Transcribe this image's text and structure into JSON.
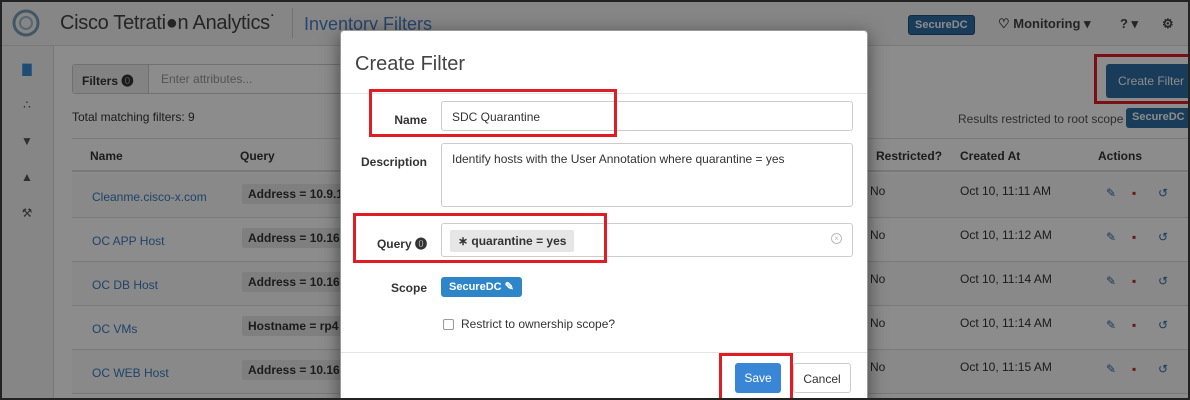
{
  "header": {
    "brand": "Cisco Tetrati●n Analytics˙",
    "page_title": "Inventory Filters",
    "scope_badge": "SecureDC",
    "monitoring_label": "♡ Monitoring ▾",
    "help_label": "? ▾",
    "settings_icon": "gear-icon"
  },
  "sidebar": {
    "items": [
      {
        "icon": "chart-icon",
        "glyph": "▇"
      },
      {
        "icon": "hierarchy-icon",
        "glyph": "∴"
      },
      {
        "icon": "shield-icon",
        "glyph": "▼"
      },
      {
        "icon": "flask-icon",
        "glyph": "▲"
      },
      {
        "icon": "wrench-icon",
        "glyph": "⚒"
      }
    ]
  },
  "filters": {
    "label": "Filters ⓿",
    "placeholder": "Enter attributes...",
    "total": "Total matching filters: 9",
    "restricted_note": "Results restricted to root scope",
    "root_scope": "SecureDC",
    "create_button": "Create Filter"
  },
  "table": {
    "columns": [
      "Name",
      "Query",
      "Restricted?",
      "Created At",
      "Actions"
    ],
    "rows": [
      {
        "name": "Cleanme.cisco-x.com",
        "query": "Address = 10.9.1",
        "restricted": "No",
        "created": "Oct 10, 11:11 AM"
      },
      {
        "name": "OC APP Host",
        "query": "Address = 10.16",
        "restricted": "No",
        "created": "Oct 10, 11:12 AM"
      },
      {
        "name": "OC DB Host",
        "query": "Address = 10.16",
        "restricted": "No",
        "created": "Oct 10, 11:14 AM"
      },
      {
        "name": "OC VMs",
        "query": "Hostname = rp4",
        "restricted": "No",
        "created": "Oct 10, 11:14 AM"
      },
      {
        "name": "OC WEB Host",
        "query": "Address = 10.16",
        "restricted": "No",
        "created": "Oct 10, 11:15 AM"
      }
    ],
    "action_icons": [
      "pencil-icon",
      "trash-icon",
      "history-icon"
    ]
  },
  "modal": {
    "title": "Create Filter",
    "name_label": "Name",
    "name_value": "SDC Quarantine",
    "description_label": "Description",
    "description_value": "Identify hosts with the User Annotation where quarantine = yes",
    "query_label": "Query ⓿",
    "query_value": "∗ quarantine = yes",
    "scope_label": "Scope",
    "scope_value": "SecureDC ✎",
    "restrict_label": "Restrict to ownership scope?",
    "save_label": "Save",
    "cancel_label": "Cancel"
  },
  "colors": {
    "accent": "#2e6da4",
    "highlight": "#e01c24",
    "link": "#3a7bbf"
  }
}
